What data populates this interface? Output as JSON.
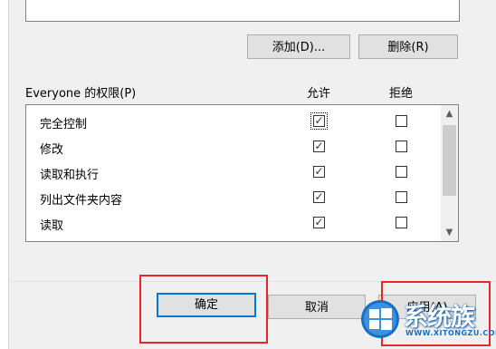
{
  "group_actions": {
    "add_label": "添加(D)...",
    "remove_label": "删除(R)"
  },
  "permissions": {
    "header": "Everyone 的权限(P)",
    "allow_col": "允许",
    "deny_col": "拒绝",
    "rows": [
      {
        "name": "完全控制",
        "allow": "✓",
        "deny": ""
      },
      {
        "name": "修改",
        "allow": "✓",
        "deny": ""
      },
      {
        "name": "读取和执行",
        "allow": "✓",
        "deny": ""
      },
      {
        "name": "列出文件夹内容",
        "allow": "✓",
        "deny": ""
      },
      {
        "name": "读取",
        "allow": "✓",
        "deny": ""
      }
    ]
  },
  "footer": {
    "ok_label": "确定",
    "cancel_label": "取消",
    "apply_label": "应用(A)"
  },
  "watermark": {
    "brand": "系统族",
    "url": "WWW.XITONGZU.COM"
  },
  "colors": {
    "highlight_red": "#e8262a",
    "focus_blue": "#0078d7"
  },
  "icons": {
    "scroll_up": "▲",
    "scroll_down": "▼"
  }
}
